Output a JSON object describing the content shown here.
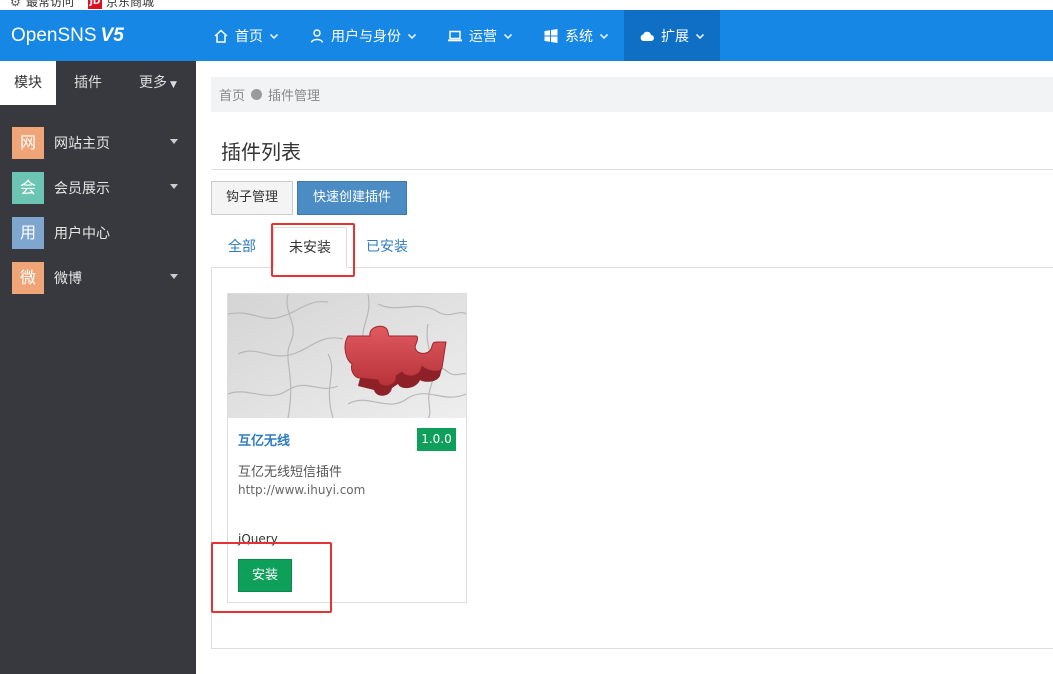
{
  "bookmarks": [
    {
      "label": "最常访问",
      "icon": "gear-icon"
    },
    {
      "label": "京东商城",
      "icon": "jd-icon",
      "icon_text": "JD"
    }
  ],
  "brand": {
    "name": "OpenSNS",
    "version": "V5"
  },
  "nav": [
    {
      "label": "首页",
      "icon": "home-icon"
    },
    {
      "label": "用户与身份",
      "icon": "user-icon"
    },
    {
      "label": "运营",
      "icon": "laptop-icon"
    },
    {
      "label": "系统",
      "icon": "windows-icon"
    },
    {
      "label": "扩展",
      "icon": "cloud-icon",
      "active": true
    }
  ],
  "sidebar": {
    "tabs": [
      {
        "label": "模块",
        "active": true
      },
      {
        "label": "插件"
      },
      {
        "label": "更多"
      }
    ],
    "items": [
      {
        "badge": "网",
        "label": "网站主页",
        "color": "#f0a579",
        "has_children": true
      },
      {
        "badge": "会",
        "label": "会员展示",
        "color": "#6cc4b3",
        "has_children": true
      },
      {
        "badge": "用",
        "label": "用户中心",
        "color": "#7ea6cf",
        "has_children": false
      },
      {
        "badge": "微",
        "label": "微博",
        "color": "#f0a579",
        "has_children": true
      }
    ]
  },
  "breadcrumb": {
    "home": "首页",
    "current": "插件管理"
  },
  "page": {
    "title": "插件列表"
  },
  "actions": {
    "hook_manage": "钩子管理",
    "quick_create": "快速创建插件"
  },
  "tabs": {
    "all": "全部",
    "uninstalled": "未安装",
    "installed": "已安装"
  },
  "plugin": {
    "name": "互亿无线",
    "version": "1.0.0",
    "description": "互亿无线短信插件",
    "url": "http://www.ihuyi.com",
    "author": "jQuery",
    "install_label": "安装"
  },
  "colors": {
    "navbar": "#1687e5",
    "sidebar": "#37393e",
    "success": "#0ea05a",
    "primary": "#4a8cc3",
    "highlight": "#e53333"
  }
}
